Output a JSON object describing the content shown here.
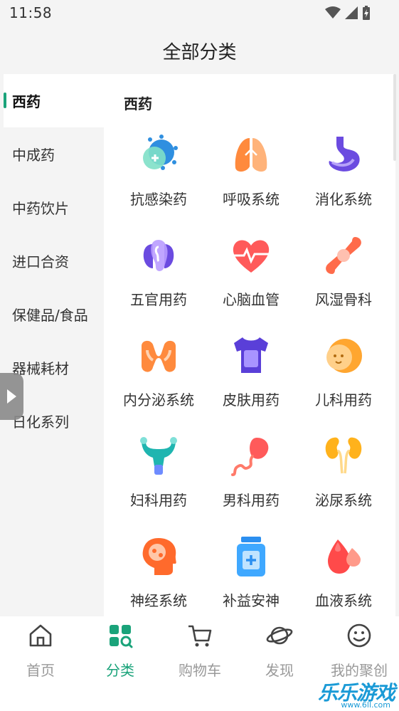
{
  "status_bar": {
    "time": "11:58"
  },
  "header": {
    "title": "全部分类"
  },
  "sidebar": {
    "items": [
      {
        "label": "西药",
        "active": true
      },
      {
        "label": "中成药",
        "active": false
      },
      {
        "label": "中药饮片",
        "active": false
      },
      {
        "label": "进口合资",
        "active": false
      },
      {
        "label": "保健品/食品",
        "active": false
      },
      {
        "label": "器械耗材",
        "active": false
      },
      {
        "label": "日化系列",
        "active": false
      }
    ]
  },
  "main": {
    "section_title": "西药",
    "categories": [
      {
        "label": "抗感染药",
        "icon": "virus-icon"
      },
      {
        "label": "呼吸系统",
        "icon": "lungs-icon"
      },
      {
        "label": "消化系统",
        "icon": "stomach-icon"
      },
      {
        "label": "五官用药",
        "icon": "ear-icon"
      },
      {
        "label": "心脑血管",
        "icon": "heart-pulse-icon"
      },
      {
        "label": "风湿骨科",
        "icon": "bone-joint-icon"
      },
      {
        "label": "内分泌系统",
        "icon": "thyroid-icon"
      },
      {
        "label": "皮肤用药",
        "icon": "shirt-icon"
      },
      {
        "label": "儿科用药",
        "icon": "baby-face-icon"
      },
      {
        "label": "妇科用药",
        "icon": "uterus-icon"
      },
      {
        "label": "男科用药",
        "icon": "sperm-icon"
      },
      {
        "label": "泌尿系统",
        "icon": "kidneys-icon"
      },
      {
        "label": "神经系统",
        "icon": "head-brain-icon"
      },
      {
        "label": "补益安神",
        "icon": "medicine-bottle-icon"
      },
      {
        "label": "血液系统",
        "icon": "blood-drops-icon"
      }
    ]
  },
  "tabbar": {
    "tabs": [
      {
        "label": "首页",
        "icon": "home-icon",
        "active": false
      },
      {
        "label": "分类",
        "icon": "category-icon",
        "active": true
      },
      {
        "label": "购物车",
        "icon": "cart-icon",
        "active": false
      },
      {
        "label": "发现",
        "icon": "planet-icon",
        "active": false
      },
      {
        "label": "我的聚创",
        "icon": "smiley-icon",
        "active": false
      }
    ]
  },
  "watermark": {
    "text": "乐乐游戏",
    "url": "www.6ll.com"
  },
  "colors": {
    "accent": "#1aa37a",
    "inactive_text": "#999999",
    "background": "#f4f4f4"
  }
}
